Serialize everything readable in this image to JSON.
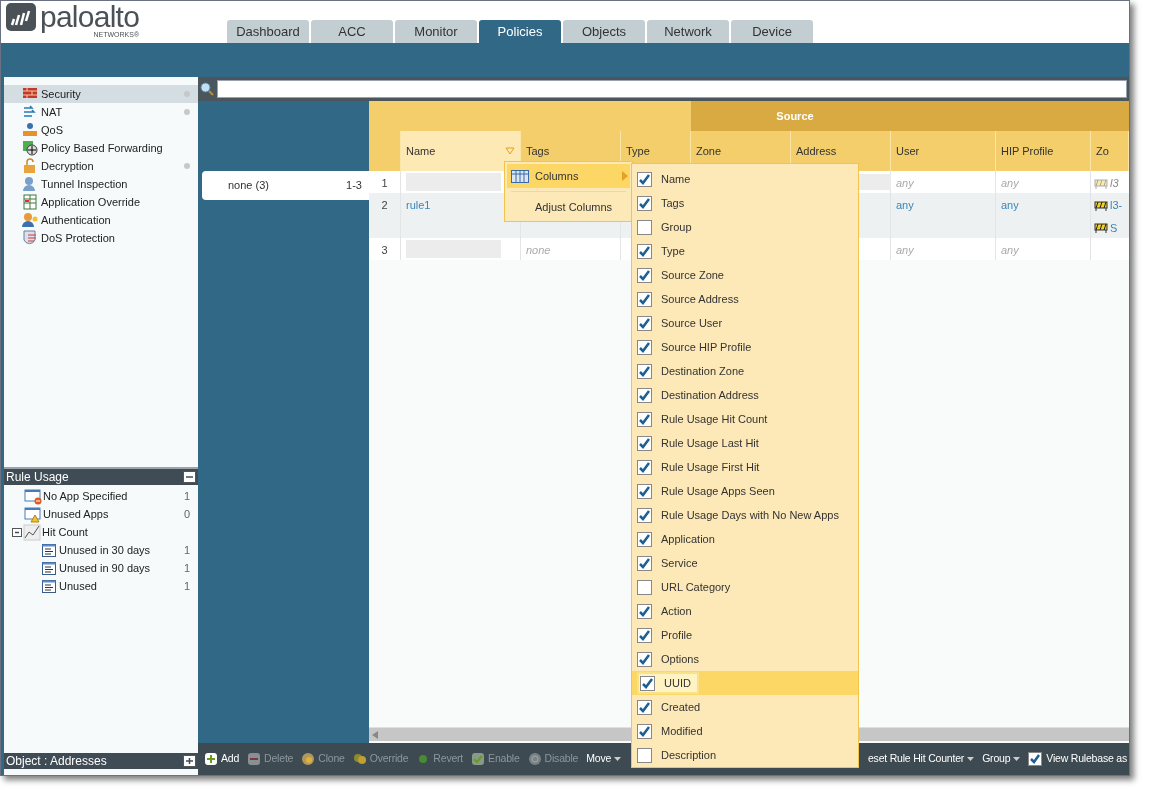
{
  "logo": {
    "name": "paloalto",
    "subtitle": "NETWORKS®"
  },
  "tabs": [
    {
      "label": "Dashboard",
      "selected": false
    },
    {
      "label": "ACC",
      "selected": false
    },
    {
      "label": "Monitor",
      "selected": false
    },
    {
      "label": "Policies",
      "selected": true
    },
    {
      "label": "Objects",
      "selected": false
    },
    {
      "label": "Network",
      "selected": false
    },
    {
      "label": "Device",
      "selected": false
    }
  ],
  "sidebar": {
    "items": [
      {
        "label": "Security",
        "selected": true,
        "dot": true
      },
      {
        "label": "NAT",
        "selected": false,
        "dot": true
      },
      {
        "label": "QoS",
        "selected": false,
        "dot": false
      },
      {
        "label": "Policy Based Forwarding",
        "selected": false,
        "dot": false
      },
      {
        "label": "Decryption",
        "selected": false,
        "dot": true
      },
      {
        "label": "Tunnel Inspection",
        "selected": false,
        "dot": false
      },
      {
        "label": "Application Override",
        "selected": false,
        "dot": false
      },
      {
        "label": "Authentication",
        "selected": false,
        "dot": false
      },
      {
        "label": "DoS Protection",
        "selected": false,
        "dot": false
      }
    ]
  },
  "rule_usage": {
    "title": "Rule Usage",
    "expanded": true,
    "items": [
      {
        "label": "No App Specified",
        "count": "1"
      },
      {
        "label": "Unused Apps",
        "count": "0"
      },
      {
        "label": "Hit Count",
        "expanded": true,
        "children": [
          {
            "label": "Unused in 30 days",
            "count": "1"
          },
          {
            "label": "Unused in 90 days",
            "count": "1"
          },
          {
            "label": "Unused",
            "count": "1"
          }
        ]
      }
    ]
  },
  "object_panel": {
    "title": "Object : Addresses",
    "expanded": false
  },
  "group_list": [
    {
      "label": "none (3)",
      "range": "1-3"
    }
  ],
  "table": {
    "group_header": "Source",
    "columns": [
      "Name",
      "Tags",
      "Type",
      "Zone",
      "Address",
      "User",
      "HIP Profile",
      "Zo"
    ],
    "rows": [
      {
        "number": "1",
        "name_redacted": true,
        "address_redacted": true,
        "user": "any",
        "hip_profile": "any",
        "zones": [
          "l3"
        ],
        "disabled": true
      },
      {
        "number": "2",
        "name": "rule1",
        "user": "any",
        "hip_profile": "any",
        "zones": [
          "l3-",
          "S"
        ],
        "disabled": false
      },
      {
        "number": "3",
        "name_redacted": true,
        "tags": "none",
        "user": "any",
        "hip_profile": "any",
        "zones": [],
        "disabled": true
      }
    ]
  },
  "column_menu": {
    "items": [
      {
        "label": "Columns",
        "selected": true,
        "submenu": true
      },
      {
        "label": "Adjust Columns",
        "selected": false,
        "submenu": false
      }
    ]
  },
  "columns_submenu": {
    "items": [
      {
        "label": "Name",
        "checked": true,
        "selected": false
      },
      {
        "label": "Tags",
        "checked": true,
        "selected": false
      },
      {
        "label": "Group",
        "checked": false,
        "selected": false
      },
      {
        "label": "Type",
        "checked": true,
        "selected": false
      },
      {
        "label": "Source Zone",
        "checked": true,
        "selected": false
      },
      {
        "label": "Source Address",
        "checked": true,
        "selected": false
      },
      {
        "label": "Source User",
        "checked": true,
        "selected": false
      },
      {
        "label": "Source HIP Profile",
        "checked": true,
        "selected": false
      },
      {
        "label": "Destination Zone",
        "checked": true,
        "selected": false
      },
      {
        "label": "Destination Address",
        "checked": true,
        "selected": false
      },
      {
        "label": "Rule Usage Hit Count",
        "checked": true,
        "selected": false
      },
      {
        "label": "Rule Usage Last Hit",
        "checked": true,
        "selected": false
      },
      {
        "label": "Rule Usage First Hit",
        "checked": true,
        "selected": false
      },
      {
        "label": "Rule Usage Apps Seen",
        "checked": true,
        "selected": false
      },
      {
        "label": "Rule Usage Days with No New Apps",
        "checked": true,
        "selected": false
      },
      {
        "label": "Application",
        "checked": true,
        "selected": false
      },
      {
        "label": "Service",
        "checked": true,
        "selected": false
      },
      {
        "label": "URL Category",
        "checked": false,
        "selected": false
      },
      {
        "label": "Action",
        "checked": true,
        "selected": false
      },
      {
        "label": "Profile",
        "checked": true,
        "selected": false
      },
      {
        "label": "Options",
        "checked": true,
        "selected": false
      },
      {
        "label": "UUID",
        "checked": true,
        "selected": true
      },
      {
        "label": "Created",
        "checked": true,
        "selected": false
      },
      {
        "label": "Modified",
        "checked": true,
        "selected": false
      },
      {
        "label": "Description",
        "checked": false,
        "selected": false
      }
    ]
  },
  "toolbar": {
    "items": [
      {
        "label": "Add",
        "disabled": false,
        "dropdown": false
      },
      {
        "label": "Delete",
        "disabled": true,
        "dropdown": false
      },
      {
        "label": "Clone",
        "disabled": true,
        "dropdown": false
      },
      {
        "label": "Override",
        "disabled": true,
        "dropdown": false
      },
      {
        "label": "Revert",
        "disabled": true,
        "dropdown": false
      },
      {
        "label": "Enable",
        "disabled": true,
        "dropdown": false
      },
      {
        "label": "Disable",
        "disabled": true,
        "dropdown": false
      },
      {
        "label": "Move",
        "disabled": false,
        "dropdown": true
      }
    ],
    "right_items": [
      {
        "label": "eset Rule Hit Counter",
        "disabled": false,
        "dropdown": true
      },
      {
        "label": "Group",
        "disabled": false,
        "dropdown": true
      }
    ],
    "view_rulebase": {
      "label": "View Rulebase as",
      "checked": true
    }
  }
}
